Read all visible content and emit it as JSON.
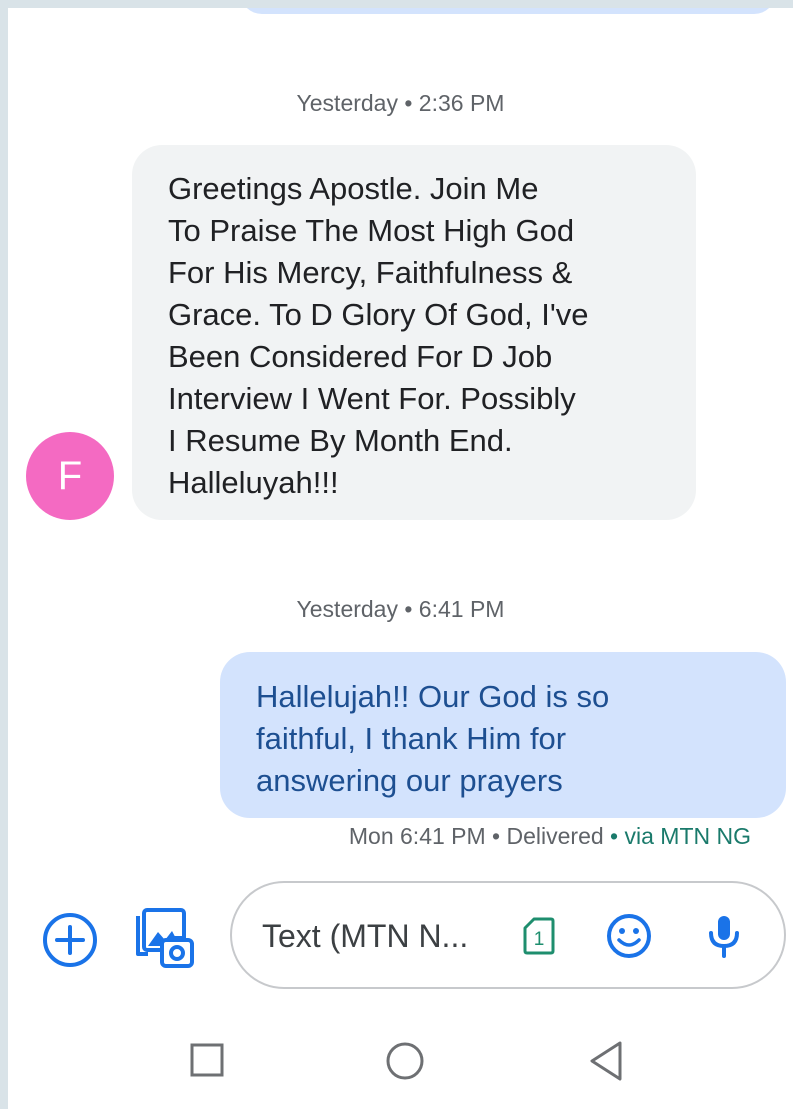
{
  "conversation": {
    "messages": [
      {
        "timestamp": "Yesterday • 2:36 PM",
        "direction": "incoming",
        "avatar_initial": "F",
        "text": "Greetings Apostle. Join Me\nTo Praise The Most High God\nFor His Mercy, Faithfulness &\nGrace. To D Glory Of God, I've\nBeen Considered For D Job\nInterview I Went For. Possibly\nI Resume By Month End.\nHalleluyah!!!"
      },
      {
        "timestamp": "Yesterday • 6:41 PM",
        "direction": "outgoing",
        "text": "Hallelujah!! Our God is so\nfaithful, I thank Him for\nanswering our prayers",
        "status": "Mon 6:41 PM • Delivered",
        "carrier": " • via MTN NG"
      }
    ]
  },
  "composer": {
    "placeholder": "Text (MTN N...",
    "sim_slot": "1"
  },
  "icons": {
    "attach": "plus-circle-icon",
    "gallery": "gallery-icon",
    "sim": "sim-card-icon",
    "emoji": "emoji-icon",
    "mic": "microphone-icon",
    "nav_recents": "square-icon",
    "nav_home": "circle-icon",
    "nav_back": "triangle-back-icon"
  },
  "colors": {
    "accent": "#1a73e8",
    "avatar": "#f46ac2",
    "incoming_bubble": "#f1f3f4",
    "outgoing_bubble": "#d3e3fd",
    "outgoing_text": "#1d4f91",
    "carrier_text": "#1a7a6b",
    "sim_icon": "#1e8e6e"
  }
}
